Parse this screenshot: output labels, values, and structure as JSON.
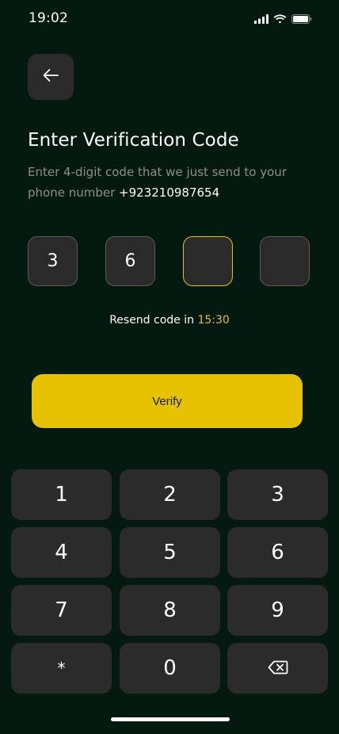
{
  "status": {
    "time": "19:02",
    "icons": [
      "signal-icon",
      "wifi-icon",
      "battery-icon"
    ]
  },
  "header": {
    "back_icon": "arrow-left-icon"
  },
  "title": "Enter Verification Code",
  "subtitle_text": "Enter 4-digit code that we just send to your phone number",
  "phone_number": "+923210987654",
  "code": {
    "digits": [
      "3",
      "6",
      "",
      ""
    ],
    "active_index": 2
  },
  "resend": {
    "label": "Resend code in",
    "timer": "15:30"
  },
  "verify_label": "Verify",
  "keypad": {
    "keys": [
      "1",
      "2",
      "3",
      "4",
      "5",
      "6",
      "7",
      "8",
      "9",
      "*",
      "0",
      "backspace"
    ],
    "backspace_icon": "backspace-icon"
  },
  "colors": {
    "background": "#041910",
    "accent": "#E6C200",
    "surface": "#2A2A2A"
  }
}
